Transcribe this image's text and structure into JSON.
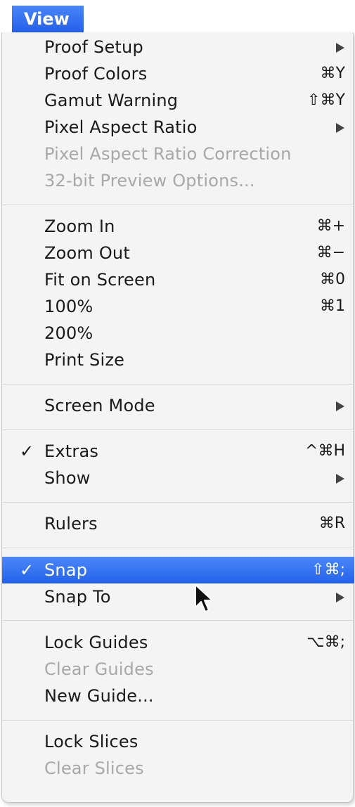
{
  "menu_title": "View",
  "items": {
    "proof_setup": {
      "label": "Proof Setup",
      "shortcut": ""
    },
    "proof_colors": {
      "label": "Proof Colors",
      "shortcut": "⌘Y"
    },
    "gamut_warning": {
      "label": "Gamut Warning",
      "shortcut": "⇧⌘Y"
    },
    "pixel_aspect_ratio": {
      "label": "Pixel Aspect Ratio",
      "shortcut": ""
    },
    "pixel_aspect_ratio_correction": {
      "label": "Pixel Aspect Ratio Correction",
      "shortcut": ""
    },
    "preview_options": {
      "label": "32-bit Preview Options...",
      "shortcut": ""
    },
    "zoom_in": {
      "label": "Zoom In",
      "shortcut": "⌘+"
    },
    "zoom_out": {
      "label": "Zoom Out",
      "shortcut": "⌘−"
    },
    "fit_on_screen": {
      "label": "Fit on Screen",
      "shortcut": "⌘0"
    },
    "zoom_100": {
      "label": "100%",
      "shortcut": "⌘1"
    },
    "zoom_200": {
      "label": "200%",
      "shortcut": ""
    },
    "print_size": {
      "label": "Print Size",
      "shortcut": ""
    },
    "screen_mode": {
      "label": "Screen Mode",
      "shortcut": ""
    },
    "extras": {
      "label": "Extras",
      "shortcut": "^⌘H",
      "check": "✓"
    },
    "show": {
      "label": "Show",
      "shortcut": ""
    },
    "rulers": {
      "label": "Rulers",
      "shortcut": "⌘R"
    },
    "snap": {
      "label": "Snap",
      "shortcut": "⇧⌘;",
      "check": "✓"
    },
    "snap_to": {
      "label": "Snap To",
      "shortcut": ""
    },
    "lock_guides": {
      "label": "Lock Guides",
      "shortcut": "⌥⌘;"
    },
    "clear_guides": {
      "label": "Clear Guides",
      "shortcut": ""
    },
    "new_guide": {
      "label": "New Guide...",
      "shortcut": ""
    },
    "lock_slices": {
      "label": "Lock Slices",
      "shortcut": ""
    },
    "clear_slices": {
      "label": "Clear Slices",
      "shortcut": ""
    }
  },
  "colors": {
    "highlight": "#2f6ef0",
    "disabled_text": "#a8a8a8",
    "menu_background": "#f4f4f4"
  },
  "icons": {
    "submenu_arrow": "triangle-right-icon",
    "check": "checkmark-icon",
    "cursor": "arrow-pointer-icon"
  }
}
